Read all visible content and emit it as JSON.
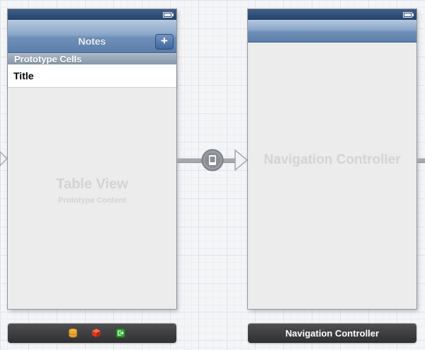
{
  "table_scene": {
    "nav_title": "Notes",
    "add_button_label": "+",
    "section_header": "Prototype Cells",
    "cell_title": "Title",
    "placeholder_title": "Table View",
    "placeholder_subtitle": "Prototype Content",
    "dock_icons": [
      "first-responder-icon",
      "object-cube-icon",
      "exit-icon"
    ]
  },
  "nav_scene": {
    "placeholder_title": "Navigation Controller",
    "bar_label": "Navigation Controller"
  },
  "colors": {
    "nav_bar": "#6f8fb8",
    "status_bar": "#27436b",
    "canvas": "#f4f5f7",
    "placeholder_text": "#d2d3d5",
    "scene_bar": "#3a3a3c"
  }
}
